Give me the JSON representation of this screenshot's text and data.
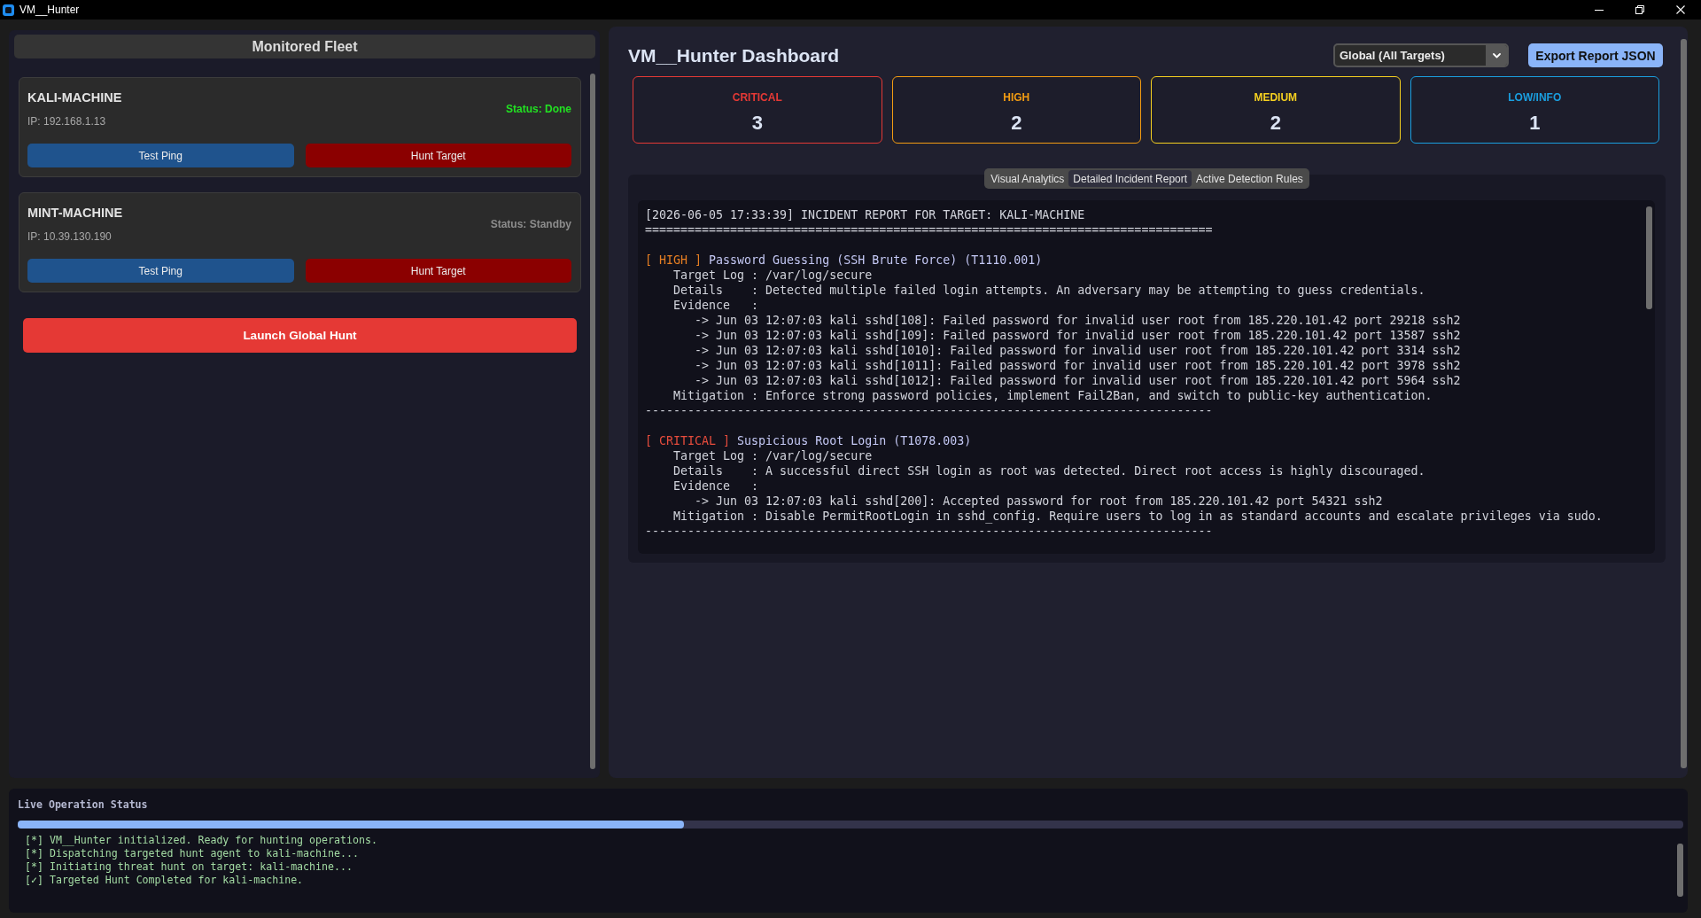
{
  "window": {
    "title": "VM__Hunter"
  },
  "fleet": {
    "title": "Monitored Fleet",
    "machines": [
      {
        "name": "KALI-MACHINE",
        "ip": "IP: 192.168.1.13",
        "status": {
          "text": "Status: Done",
          "color": "#22e022"
        },
        "ping_button": "Test Ping",
        "hunt_button": "Hunt Target"
      },
      {
        "name": "MINT-MACHINE",
        "ip": "IP: 10.39.130.190",
        "status": {
          "text": "Status: Standby",
          "color": "#8c8c8c"
        },
        "ping_button": "Test Ping",
        "hunt_button": "Hunt Target"
      }
    ],
    "launch_button": "Launch Global Hunt"
  },
  "dashboard": {
    "title": "VM__Hunter Dashboard",
    "scope": {
      "value": "Global (All Targets)"
    },
    "export_button": "Export Report JSON",
    "severity_cards": [
      {
        "label": "CRITICAL",
        "count": "3",
        "color": "#e53935"
      },
      {
        "label": "HIGH",
        "count": "2",
        "color": "#f39c12"
      },
      {
        "label": "MEDIUM",
        "count": "2",
        "color": "#f5d020"
      },
      {
        "label": "LOW/INFO",
        "count": "1",
        "color": "#1a9fe0"
      }
    ],
    "tabs": [
      {
        "label": "Visual Analytics",
        "selected": false
      },
      {
        "label": "Detailed Incident Report",
        "selected": true
      },
      {
        "label": "Active Detection Rules",
        "selected": false
      }
    ],
    "report": {
      "header": "[2026-06-05 17:33:39] INCIDENT REPORT FOR TARGET: KALI-MACHINE",
      "separator": "================================================================================",
      "findings": [
        {
          "tag": "[ HIGH ]",
          "color": "#e67e22",
          "title": "Password Guessing (SSH Brute Force) (T1110.001)",
          "lines": [
            {
              "kind": "field",
              "text": "Target Log : /var/log/secure"
            },
            {
              "kind": "field",
              "text": "Details    : Detected multiple failed login attempts. An adversary may be attempting to guess credentials."
            },
            {
              "kind": "field",
              "text": "Evidence   :"
            },
            {
              "kind": "evidence",
              "text": "-> Jun 03 12:07:03 kali sshd[108]: Failed password for invalid user root from 185.220.101.42 port 29218 ssh2"
            },
            {
              "kind": "evidence",
              "text": "-> Jun 03 12:07:03 kali sshd[109]: Failed password for invalid user root from 185.220.101.42 port 13587 ssh2"
            },
            {
              "kind": "evidence",
              "text": "-> Jun 03 12:07:03 kali sshd[1010]: Failed password for invalid user root from 185.220.101.42 port 3314 ssh2"
            },
            {
              "kind": "evidence",
              "text": "-> Jun 03 12:07:03 kali sshd[1011]: Failed password for invalid user root from 185.220.101.42 port 3978 ssh2"
            },
            {
              "kind": "evidence",
              "text": "-> Jun 03 12:07:03 kali sshd[1012]: Failed password for invalid user root from 185.220.101.42 port 5964 ssh2"
            },
            {
              "kind": "field",
              "text": "Mitigation : Enforce strong password policies, implement Fail2Ban, and switch to public-key authentication."
            }
          ],
          "separator": "--------------------------------------------------------------------------------"
        },
        {
          "tag": "[ CRITICAL ]",
          "color": "#e74c3c",
          "title": "Suspicious Root Login (T1078.003)",
          "lines": [
            {
              "kind": "field",
              "text": "Target Log : /var/log/secure"
            },
            {
              "kind": "field",
              "text": "Details    : A successful direct SSH login as root was detected. Direct root access is highly discouraged."
            },
            {
              "kind": "field",
              "text": "Evidence   :"
            },
            {
              "kind": "evidence",
              "text": "-> Jun 03 12:07:03 kali sshd[200]: Accepted password for root from 185.220.101.42 port 54321 ssh2"
            },
            {
              "kind": "field",
              "text": "Mitigation : Disable PermitRootLogin in sshd_config. Require users to log in as standard accounts and escalate privileges via sudo."
            }
          ],
          "separator": "--------------------------------------------------------------------------------"
        }
      ]
    }
  },
  "status_panel": {
    "title": "Live Operation Status",
    "progress": {
      "level": 0.4
    },
    "log": [
      "[*] VM__Hunter initialized. Ready for hunting operations.",
      "[*] Dispatching targeted hunt agent to kali-machine...",
      "[*] Initiating threat hunt on target: kali-machine...",
      "[✓] Targeted Hunt Completed for kali-machine."
    ]
  }
}
